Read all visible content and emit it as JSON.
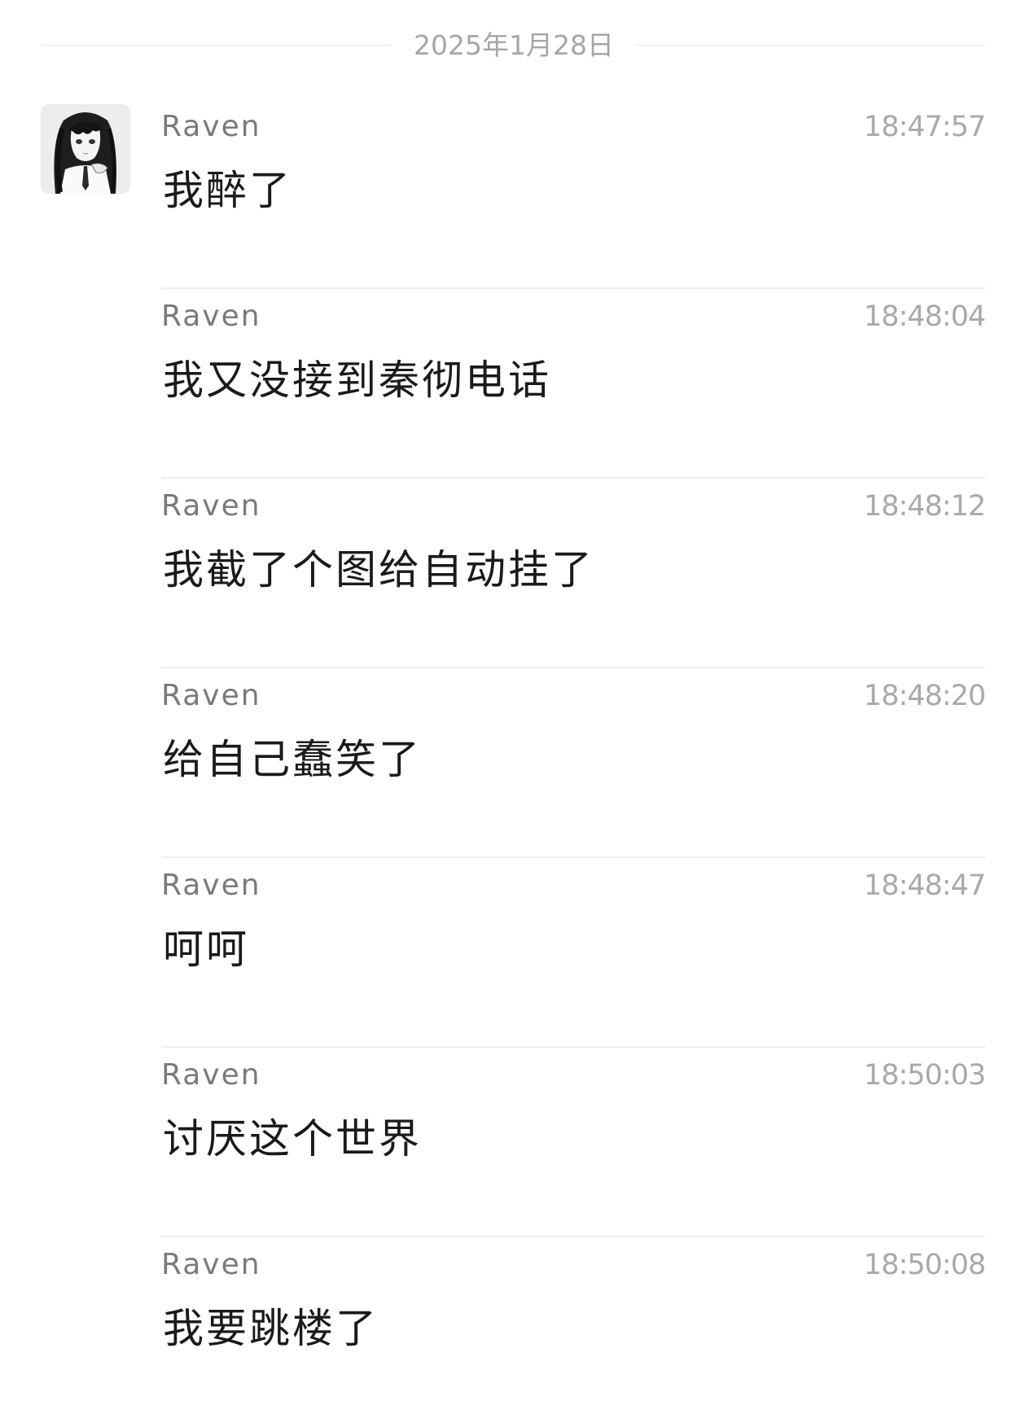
{
  "date_divider": "2025年1月28日",
  "contact": {
    "avatar_icon": "anime-girl-avatar"
  },
  "messages": [
    {
      "sender": "Raven",
      "time": "18:47:57",
      "text": "我醉了"
    },
    {
      "sender": "Raven",
      "time": "18:48:04",
      "text": "我又没接到秦彻电话"
    },
    {
      "sender": "Raven",
      "time": "18:48:12",
      "text": "我截了个图给自动挂了"
    },
    {
      "sender": "Raven",
      "time": "18:48:20",
      "text": "给自己蠢笑了"
    },
    {
      "sender": "Raven",
      "time": "18:48:47",
      "text": "呵呵"
    },
    {
      "sender": "Raven",
      "time": "18:50:03",
      "text": "讨厌这个世界"
    },
    {
      "sender": "Raven",
      "time": "18:50:08",
      "text": "我要跳楼了"
    }
  ],
  "colors": {
    "sender": "#7a7a7a",
    "time": "#a9a9a9",
    "text": "#1a1a1a",
    "divider": "#ececec"
  }
}
